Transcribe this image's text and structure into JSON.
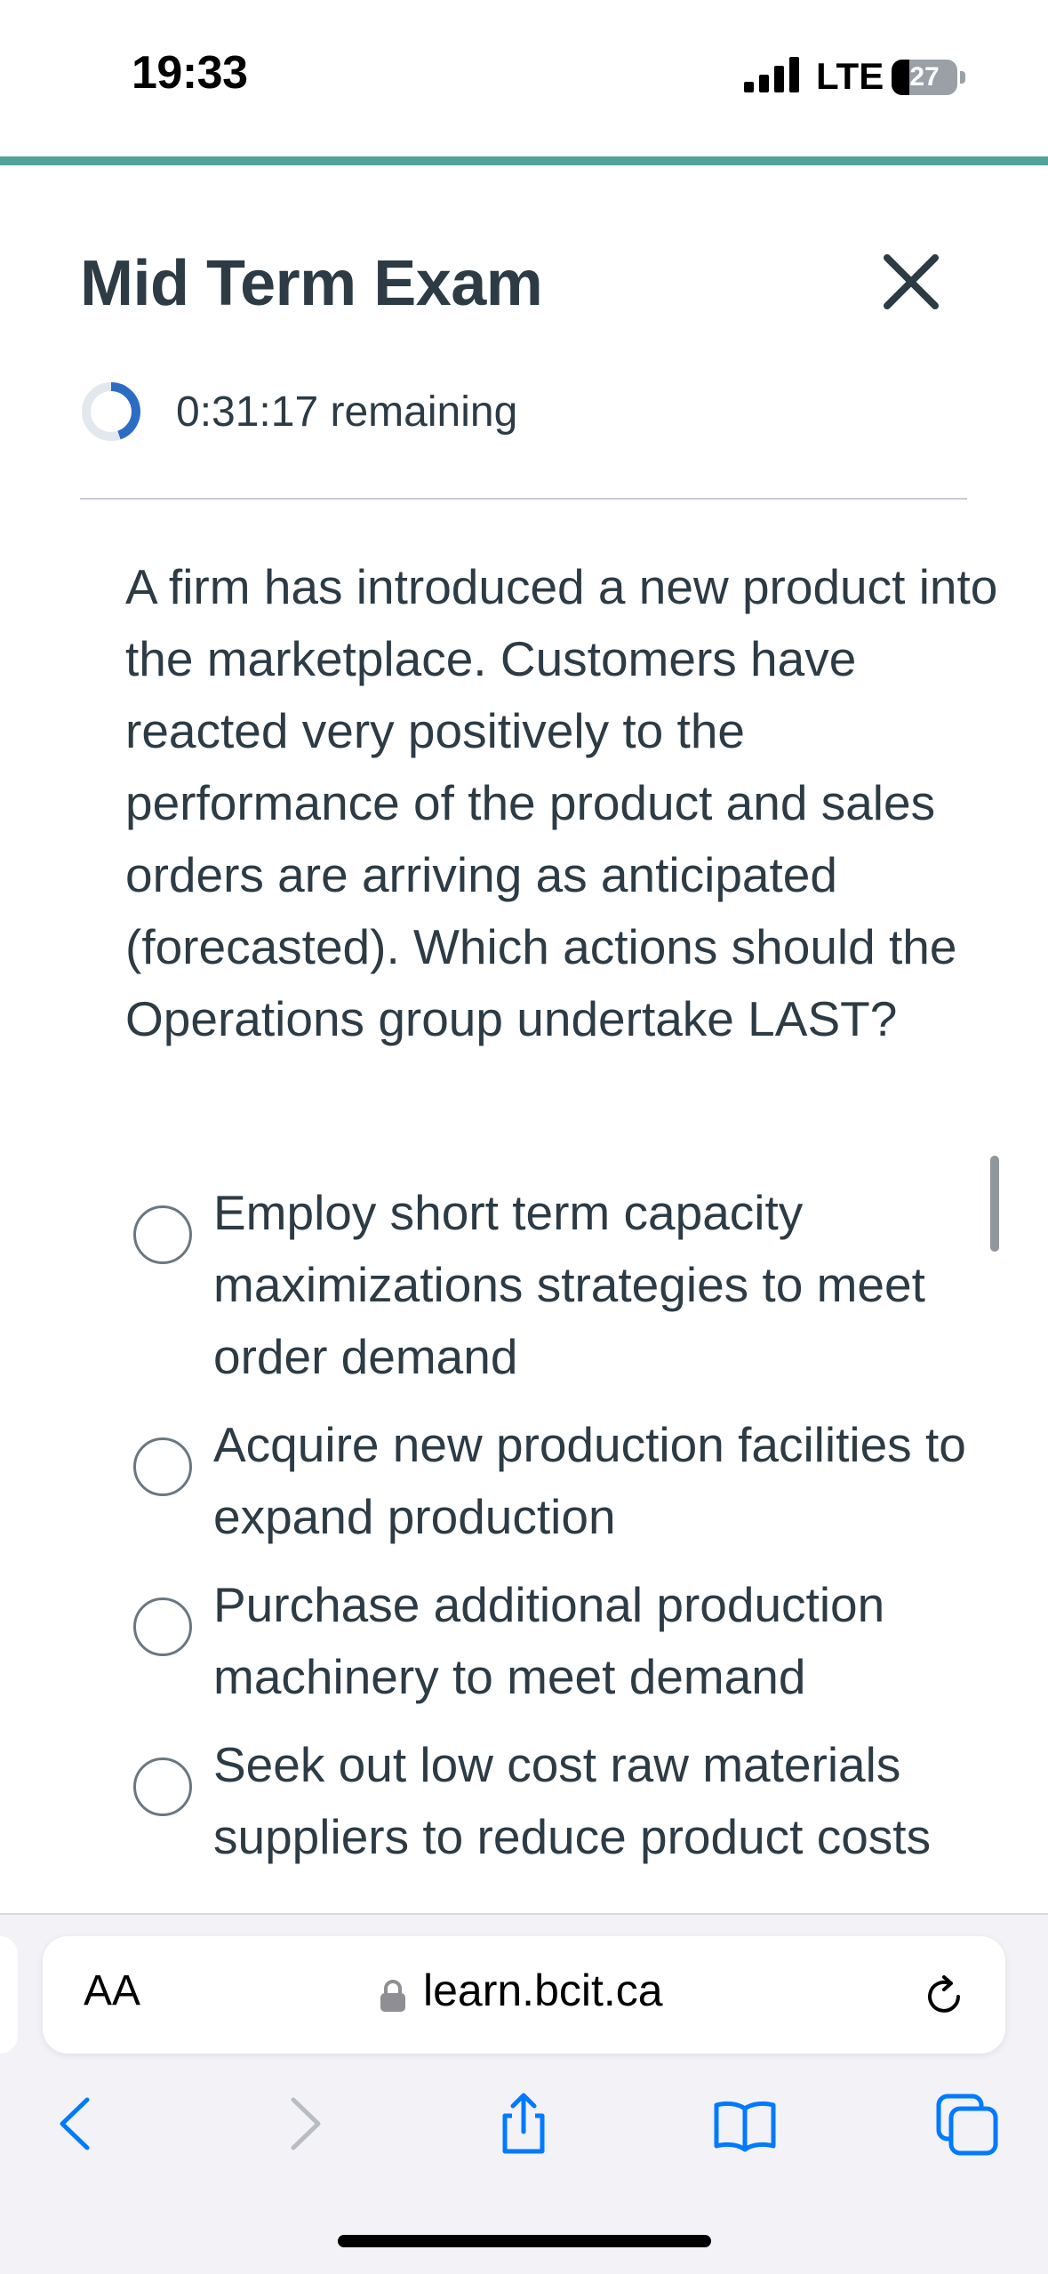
{
  "status_bar": {
    "time": "19:33",
    "network": "LTE",
    "battery_level": "27"
  },
  "exam": {
    "title": "Mid Term Exam",
    "timer_text": "0:31:17 remaining"
  },
  "question": {
    "text": "A firm has introduced a new product into the marketplace. Customers have reacted very positively to the performance of the product and sales orders are arriving as anticipated (forecasted). Which actions should the Operations group undertake LAST?",
    "options": [
      {
        "label": "Employ short term capacity maximizations strategies to meet order demand",
        "selected": false
      },
      {
        "label": "Acquire new production facilities to expand production",
        "selected": false
      },
      {
        "label": "Purchase additional production machinery to meet demand",
        "selected": false
      },
      {
        "label": "Seek out low cost raw materials suppliers to reduce product costs",
        "selected": false
      }
    ]
  },
  "browser": {
    "text_size_label": "AA",
    "url": "learn.bcit.ca"
  },
  "colors": {
    "accent_rule": "#4fa39a",
    "timer_ring": "#2b6cc4",
    "ios_blue": "#007aff",
    "text": "#2d3b45"
  },
  "icons": {
    "close": "close-icon",
    "timer": "timer-ring-icon",
    "lock": "lock-icon",
    "reload": "reload-icon",
    "back": "chevron-left-icon",
    "forward": "chevron-right-icon",
    "share": "share-icon",
    "bookmarks": "book-icon",
    "tabs": "tabs-icon"
  }
}
